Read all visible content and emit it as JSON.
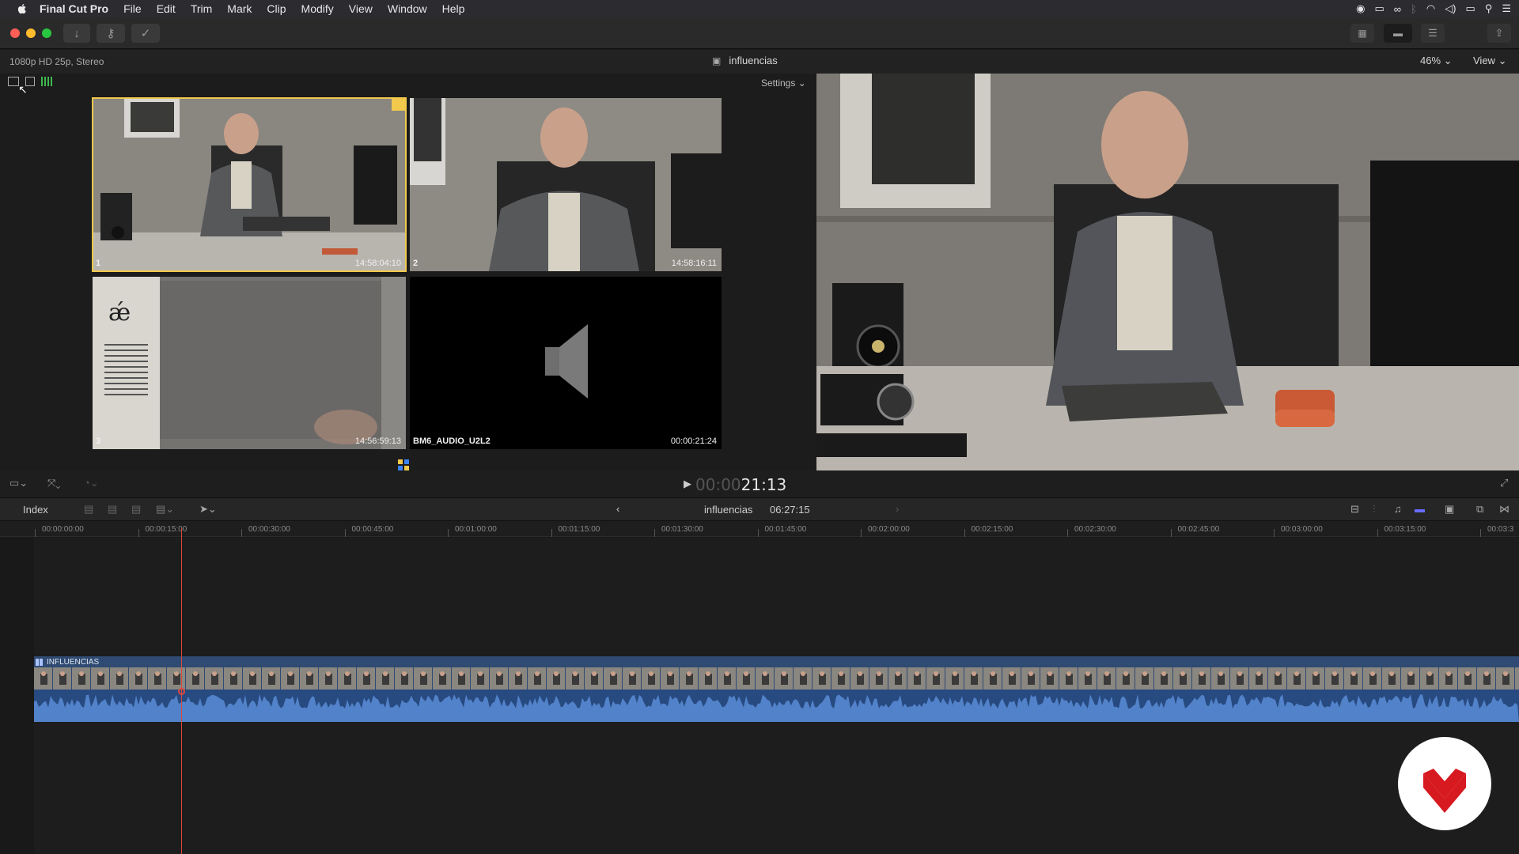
{
  "menubar": {
    "app_name": "Final Cut Pro",
    "items": [
      "File",
      "Edit",
      "Trim",
      "Mark",
      "Clip",
      "Modify",
      "View",
      "Window",
      "Help"
    ]
  },
  "header": {
    "format": "1080p HD 25p, Stereo",
    "project_name": "influencias",
    "zoom": "46%",
    "view_label": "View"
  },
  "angle_viewer": {
    "settings_label": "Settings",
    "angles": [
      {
        "label": "1",
        "timecode": "14:58:04:10",
        "active": true
      },
      {
        "label": "2",
        "timecode": "14:58:16:11",
        "active": false
      },
      {
        "label": "3",
        "timecode": "14:56:59:13",
        "active": false
      },
      {
        "label": "BM6_AUDIO_U2L2",
        "timecode": "00:00:21:24",
        "active": false
      }
    ]
  },
  "playback": {
    "timecode_dim": "00:00",
    "timecode_bright": "21:13"
  },
  "timeline": {
    "index_label": "Index",
    "name": "influencias",
    "duration": "06:27:15",
    "clip_name": "INFLUENCIAS",
    "ruler": [
      "00:00:00:00",
      "00:00:15:00",
      "00:00:30:00",
      "00:00:45:00",
      "00:01:00:00",
      "00:01:15:00",
      "00:01:30:00",
      "00:01:45:00",
      "00:02:00:00",
      "00:02:15:00",
      "00:02:30:00",
      "00:02:45:00",
      "00:03:00:00",
      "00:03:15:00",
      "00:03:3"
    ]
  },
  "colors": {
    "accent_yellow": "#f2c94c",
    "clip_blue": "#2f4b73",
    "playhead_red": "#e0483c",
    "logo_red": "#d71920"
  }
}
